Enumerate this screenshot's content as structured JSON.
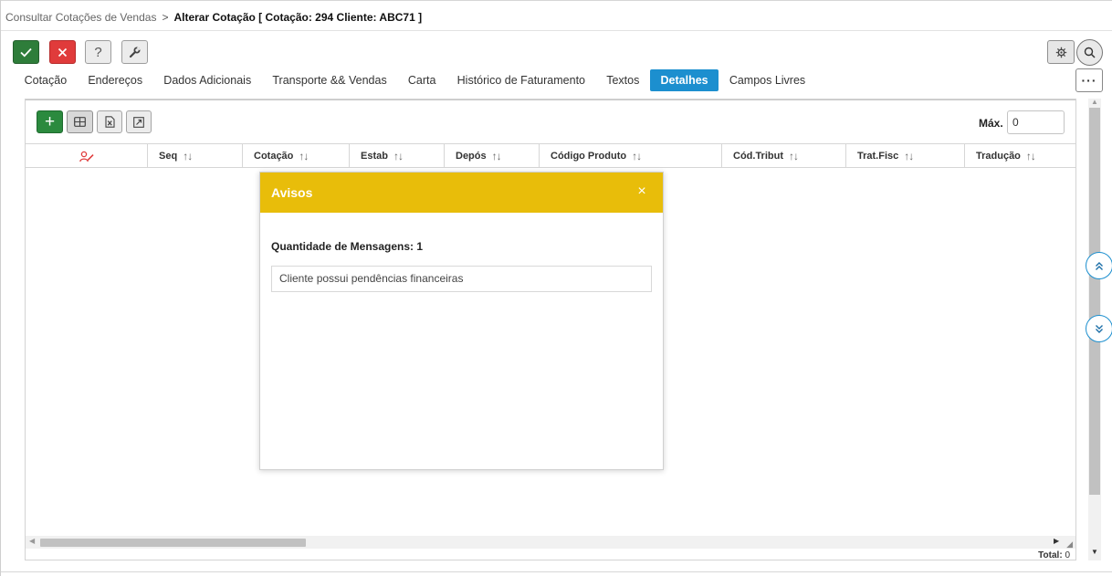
{
  "breadcrumb": {
    "parent": "Consultar Cotações de Vendas",
    "separator": ">",
    "current": "Alterar Cotação [ Cotação: 294 Cliente: ABC71 ]"
  },
  "toolbar": {
    "help_label": "?",
    "more_label": "···"
  },
  "tabs": [
    {
      "label": "Cotação",
      "active": false
    },
    {
      "label": "Endereços",
      "active": false
    },
    {
      "label": "Dados Adicionais",
      "active": false
    },
    {
      "label": "Transporte && Vendas",
      "active": false
    },
    {
      "label": "Carta",
      "active": false
    },
    {
      "label": "Histórico de Faturamento",
      "active": false
    },
    {
      "label": "Textos",
      "active": false
    },
    {
      "label": "Detalhes",
      "active": true
    },
    {
      "label": "Campos Livres",
      "active": false
    }
  ],
  "grid": {
    "add_label": "+",
    "max_label": "Máx.",
    "max_value": "0",
    "columns": [
      "Seq",
      "Cotação",
      "Estab",
      "Depós",
      "Código Produto",
      "Cód.Tribut",
      "Trat.Fisc",
      "Tradução"
    ],
    "sort_glyph": "↑↓",
    "total_label": "Total:",
    "total_value": "0"
  },
  "modal": {
    "title": "Avisos",
    "close_label": "×",
    "count_label": "Quantidade de Mensagens: 1",
    "messages": [
      "Cliente possui pendências financeiras"
    ]
  },
  "colors": {
    "accent": "#1c8fcf",
    "confirm": "#2e7d3a",
    "cancel": "#e03b3b",
    "modal_header": "#e8bd0a"
  },
  "icons": {
    "confirm": "check-icon",
    "cancel": "close-icon",
    "help": "question-icon",
    "tool": "wrench-icon",
    "settings": "gear-icon",
    "search": "search-icon",
    "more": "ellipsis-icon",
    "add": "plus-icon",
    "grid": "grid-icon",
    "excel": "excel-icon",
    "expand": "expand-icon",
    "user_column": "user-edit-icon",
    "scroll_up": "double-chevron-up-icon",
    "scroll_down": "double-chevron-down-icon"
  }
}
